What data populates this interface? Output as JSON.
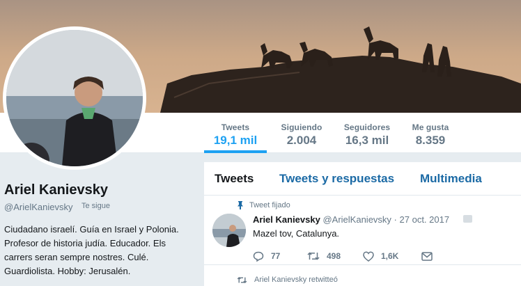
{
  "stats": {
    "tweets": {
      "label": "Tweets",
      "value": "19,1 mil"
    },
    "following": {
      "label": "Siguiendo",
      "value": "2.004"
    },
    "followers": {
      "label": "Seguidores",
      "value": "16,3 mil"
    },
    "likes": {
      "label": "Me gusta",
      "value": "8.359"
    }
  },
  "profile": {
    "name": "Ariel Kanievsky",
    "handle": "@ArielKanievsky",
    "follows_you": "Te sigue",
    "bio": "Ciudadano israelí. Guía en Israel y Polonia. Profesor de historia judía. Educador. Els carrers seran sempre nostres. Culé. Guardiolista. Hobby: Jerusalén."
  },
  "tabs": {
    "tweets": "Tweets",
    "replies": "Tweets y respuestas",
    "media": "Multimedia"
  },
  "pinned_tweet": {
    "pin_label": "Tweet fijado",
    "name": "Ariel Kanievsky",
    "handle": "@ArielKanievsky",
    "separator": "·",
    "date": "27 oct. 2017",
    "text": "Mazel tov, Catalunya.",
    "replies": "77",
    "retweets": "498",
    "likes": "1,6K"
  },
  "retweet_row": {
    "label": "Ariel Kanievsky retwitteó"
  },
  "colors": {
    "accent": "#1da1f2",
    "tab_link": "#1b6aa5",
    "muted": "#657786",
    "background": "#e6ecf0"
  },
  "icons": {
    "pin": "pin-icon",
    "reply": "reply-icon",
    "retweet": "retweet-icon",
    "like": "heart-icon",
    "dm": "envelope-icon"
  }
}
